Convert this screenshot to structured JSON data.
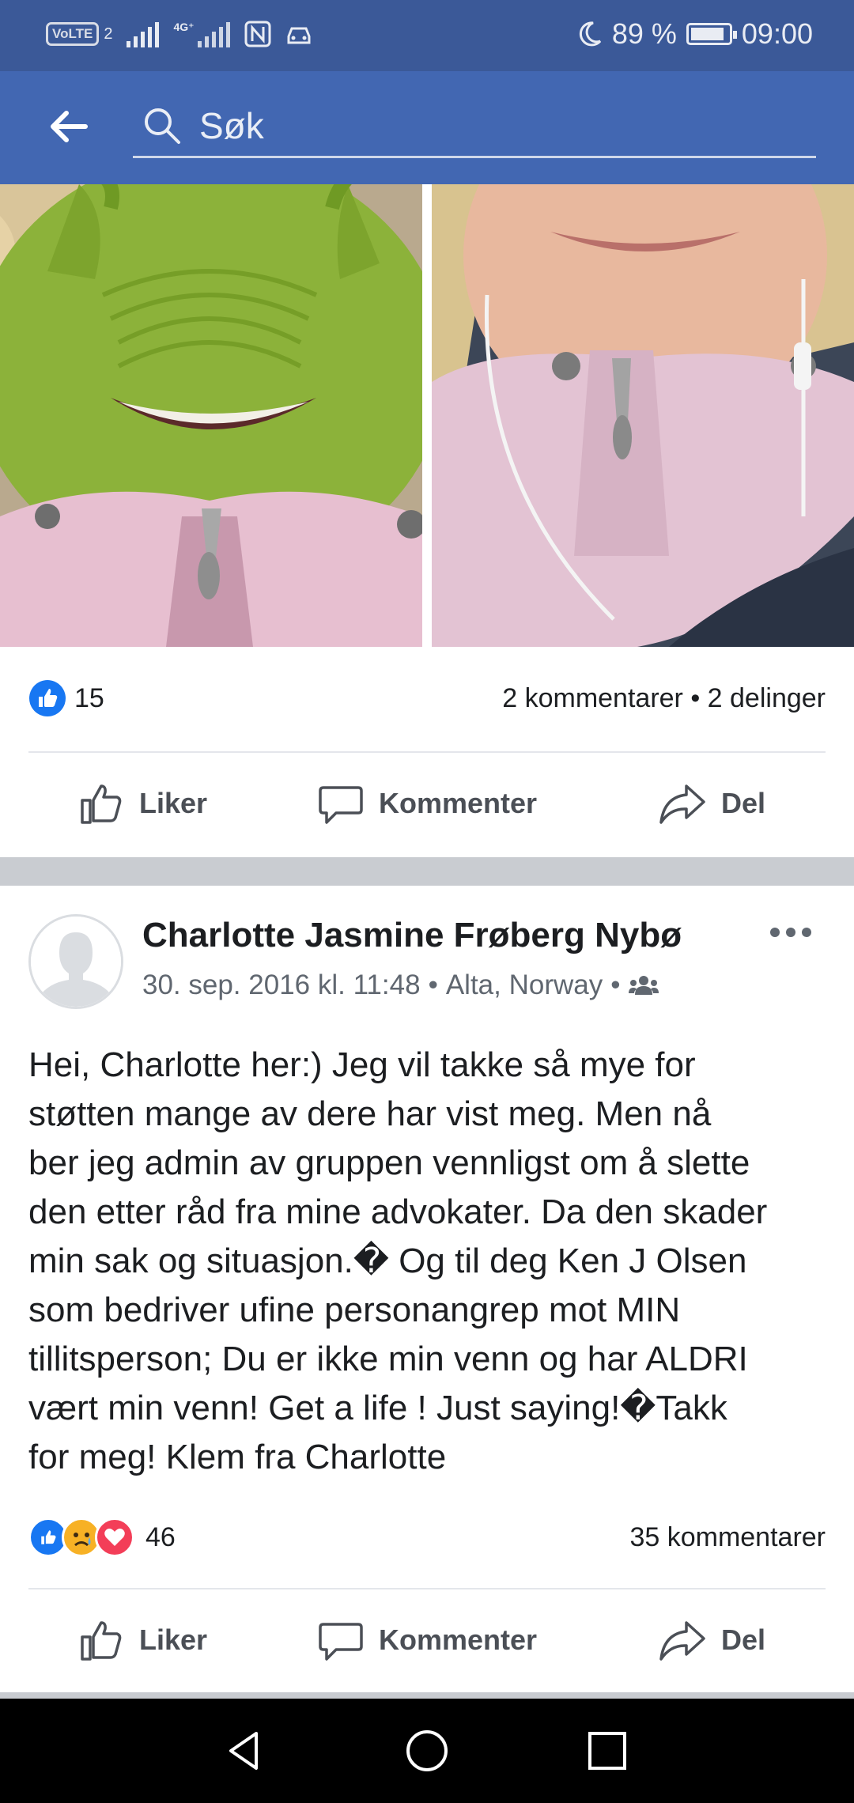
{
  "status_bar": {
    "volte_label": "VoLTE",
    "sim_label": "2",
    "network_label": "4G⁺",
    "battery_percent": "89 %",
    "battery_level": 0.89,
    "time": "09:00"
  },
  "header": {
    "search_placeholder": "Søk"
  },
  "post1": {
    "like_count": "15",
    "comments_shares": "2 kommentarer • 2 delinger",
    "actions": {
      "like": "Liker",
      "comment": "Kommenter",
      "share": "Del"
    }
  },
  "post2": {
    "author": "Charlotte Jasmine Frøberg Nybø",
    "date": "30. sep. 2016 kl. 11:48",
    "separator": "•",
    "location": "Alta, Norway",
    "body_lines": [
      "Hei, Charlotte her:) Jeg vil takke så mye for",
      "støtten mange av dere har vist meg. Men nå",
      "ber jeg admin av gruppen vennligst om å slette",
      "den etter råd fra mine advokater. Da den skader",
      "min sak og situasjon.� Og til deg Ken J Olsen",
      "som bedriver ufine personangrep mot MIN",
      "tillitsperson; Du er ikke min venn og har ALDRI",
      "vært min venn! Get a life ! Just saying!�Takk",
      "for meg! Klem fra Charlotte"
    ],
    "reaction_count": "46",
    "comments": "35 kommentarer",
    "actions": {
      "like": "Liker",
      "comment": "Kommenter",
      "share": "Del"
    }
  },
  "colors": {
    "status_bar": "#3b5998",
    "header": "#4267b2",
    "like_blue": "#1877f2",
    "love_red": "#f33e58",
    "sad_yellow": "#f7b125"
  }
}
